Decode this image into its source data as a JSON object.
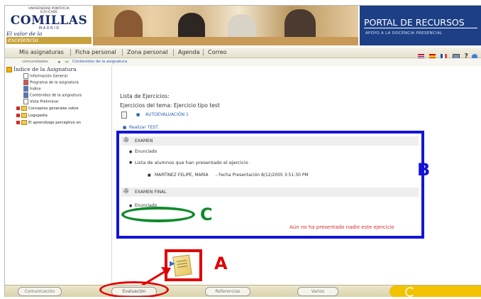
{
  "header": {
    "logo": {
      "top_line": "UNIVERSIDAD PONTIFICIA",
      "sub_line": "ICAI ICADE",
      "name": "COMILLAS",
      "madrid": "M A D R I D",
      "slogan": "El valor de la",
      "slogan2": "excelencia"
    },
    "portal_title": "PORTAL DE RECURSOS",
    "portal_subtitle": "APOYO A LA DOCENCIA PRESENCIAL"
  },
  "menu": {
    "items": [
      "Mis asignaturas",
      "Ficha personal",
      "Zona personal",
      "Agenda",
      "Correo"
    ],
    "toolbar_icons": [
      "uk-flag-icon",
      "spain-flag-icon",
      "france-flag-icon",
      "screen-icon",
      "help-icon",
      "globe-icon"
    ]
  },
  "breadcrumb": {
    "left": "comunidades",
    "link": "Contenidos de la asignatura"
  },
  "sidebar": {
    "root": "Índice de la Asignatura",
    "items": [
      "Información General",
      "Programa de la asignatura",
      "Índice",
      "Contenidos de la asignatura",
      "Vista Preliminar",
      "Conceptos generales sobre",
      "Logopedia",
      "El aprendizaje perceptivo en"
    ]
  },
  "main": {
    "list_title": "Lista de Ejercicios:",
    "exercise_title": "Ejercicios del tema: Ejercicio tipo test",
    "autoeval": "AUTOEVALUACIÓN 1",
    "realizar": "Realizar TEST.",
    "box": {
      "row1": "EXAMEN",
      "enunciado1": "Enunciado",
      "lista_alumnos": "Lista de alumnos que han presentado el ejercicio",
      "alumno": "MARTÍNEZ FELIPE, MARÍA",
      "fecha": "- Fecha Presentación 8/12/2005 3:51:30 PM",
      "row2": "EXAMEN FINAL",
      "enunciado2": "Enunciado",
      "no_presentado": "Aún no ha presentado nadie este ejercicio"
    }
  },
  "annotations": {
    "a": "A",
    "b": "B",
    "c": "C",
    "red": "#e00000",
    "blue": "#1414d8",
    "green": "#0f8a2a"
  },
  "bottom_tabs": [
    "Comunicación",
    "Evaluación",
    "Referencias",
    "Varios"
  ],
  "colors": {
    "portal_bg": "#1c3f86",
    "menu_bg": "#ece7cc",
    "yellow": "#f2c200"
  }
}
